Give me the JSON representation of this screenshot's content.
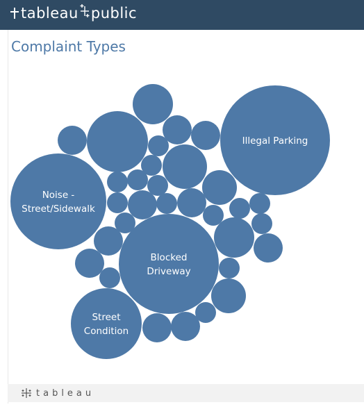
{
  "header": {
    "brand_left": "tableau",
    "brand_right": "public",
    "colors": {
      "bar": "#2f4a63",
      "text": "#ffffff"
    }
  },
  "viz": {
    "title": "Complaint Types",
    "bubble_color": "#4e79a7",
    "title_color": "#4e79a7"
  },
  "footer": {
    "logo_text": "tableau",
    "icon": "tableau-logo-icon"
  },
  "chart_data": {
    "type": "packed-bubble",
    "bubbles": [
      {
        "label": [
          "Illegal Parking"
        ]
      },
      {
        "label": [
          "Blocked",
          "Driveway"
        ]
      },
      {
        "label": [
          "Noise -",
          "Street/Sidewalk"
        ]
      },
      {
        "label": [
          "Street",
          "Condition"
        ]
      }
    ],
    "unlabeled_bubble_count": 36
  }
}
